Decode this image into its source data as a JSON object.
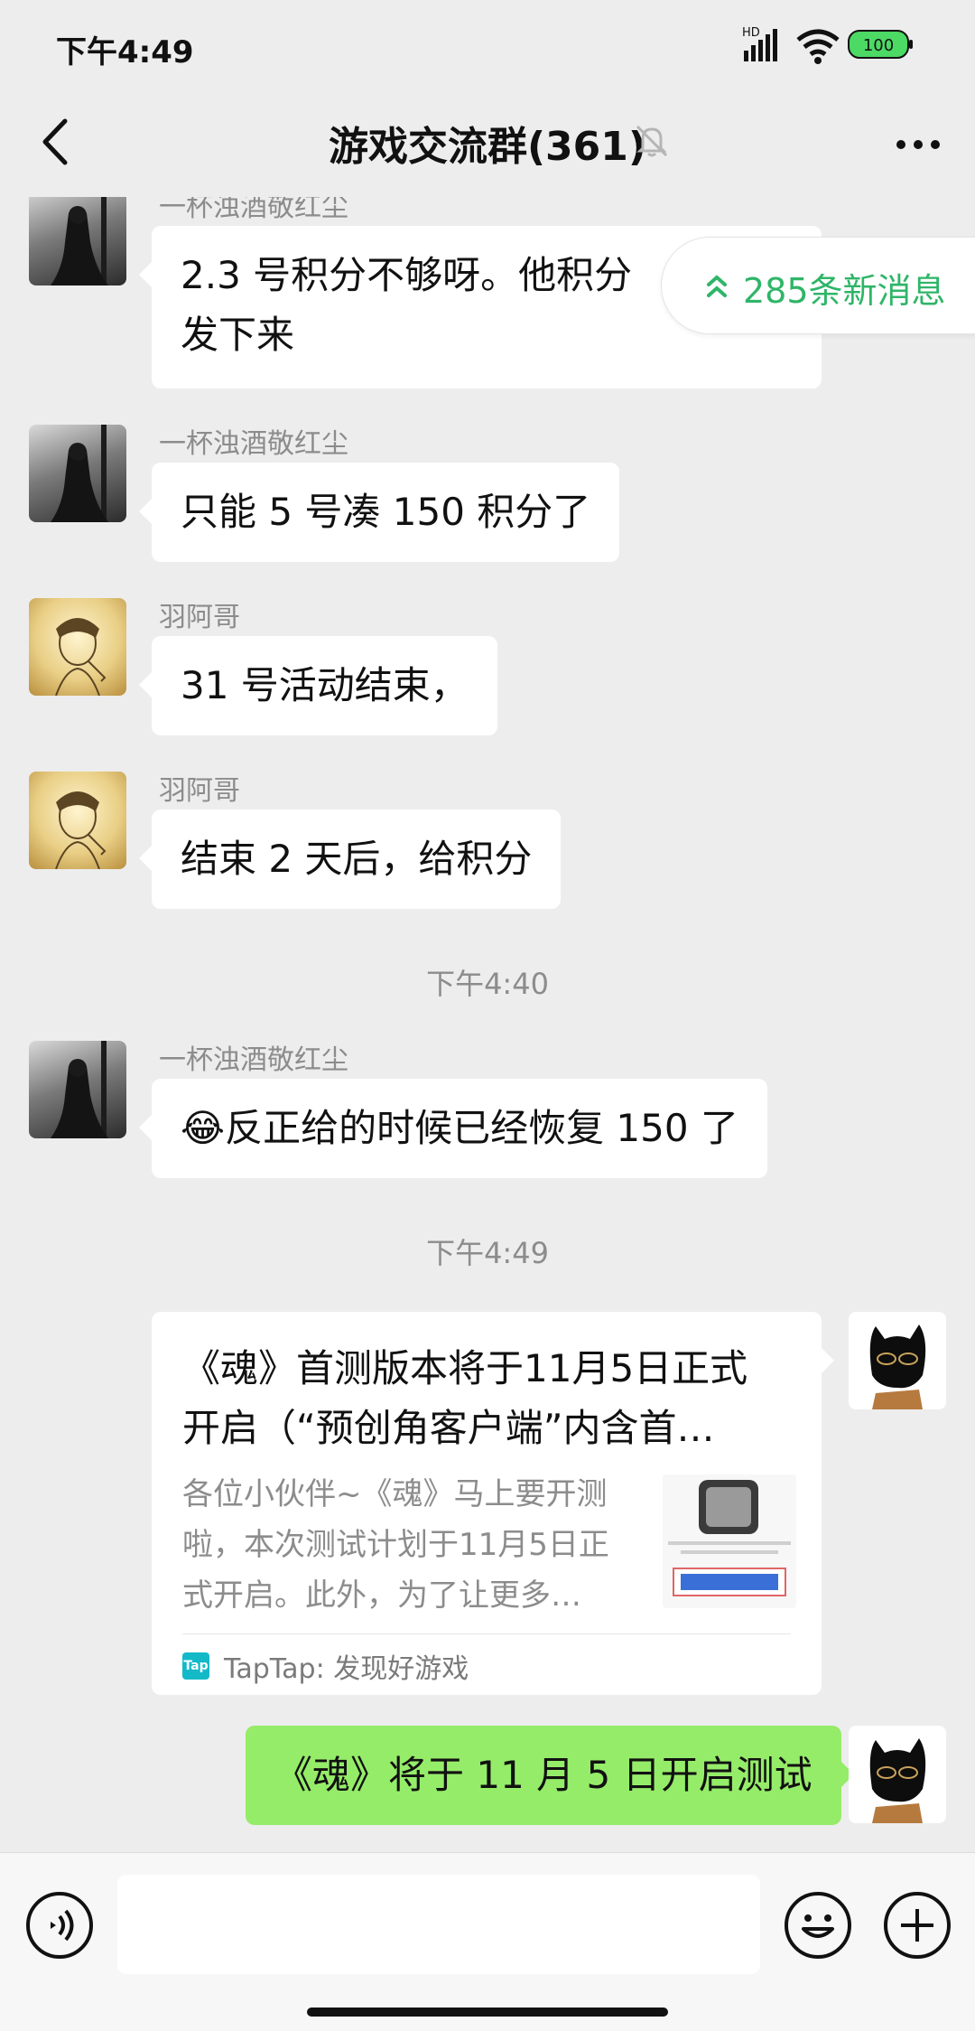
{
  "status_bar": {
    "time": "下午4:49",
    "signal_label": "HD",
    "battery": "100"
  },
  "header": {
    "title": "游戏交流群(361)",
    "back_icon": "chevron-left-icon",
    "mute_icon": "bell-off-icon",
    "more_icon": "more-dots-icon"
  },
  "new_messages_pill": {
    "label": "285条新消息",
    "color": "#2fb568"
  },
  "messages": [
    {
      "sender": "一杯浊酒敬红尘",
      "avatar": "dark-figure-avatar",
      "text_line1": "2.3 号积分不够呀。他积分",
      "text_line2": "发下来"
    },
    {
      "sender": "一杯浊酒敬红尘",
      "avatar": "dark-figure-avatar",
      "text": "只能 5 号凑 150 积分了"
    },
    {
      "sender": "羽阿哥",
      "avatar": "sketch-avatar",
      "text": "31 号活动结束，"
    },
    {
      "sender": "羽阿哥",
      "avatar": "sketch-avatar",
      "text": "结束 2 天后，给积分"
    },
    {
      "time_separator": "下午4:40"
    },
    {
      "sender": "一杯浊酒敬红尘",
      "avatar": "dark-figure-avatar",
      "emoji": "😂",
      "text": "反正给的时候已经恢复 150 了"
    },
    {
      "time_separator": "下午4:49"
    }
  ],
  "link_card": {
    "title_line1": "《魂》首测版本将于11月5日正式",
    "title_line2": "开启（“预创角客户端”内含首…",
    "desc_line1": "各位小伙伴~《魂》马上要开测",
    "desc_line2": "啦，本次测试计划于11月5日正",
    "desc_line3": "式开启。此外，为了让更多…",
    "source_logo": "Tap",
    "source": "TapTap: 发现好游戏"
  },
  "own_message": {
    "text": "《魂》将于 11 月 5 日开启测试",
    "bubble_color": "#95ec69"
  },
  "input_bar": {
    "voice_icon": "voice-icon",
    "emoji_icon": "emoji-icon",
    "plus_icon": "plus-icon",
    "input_value": ""
  }
}
